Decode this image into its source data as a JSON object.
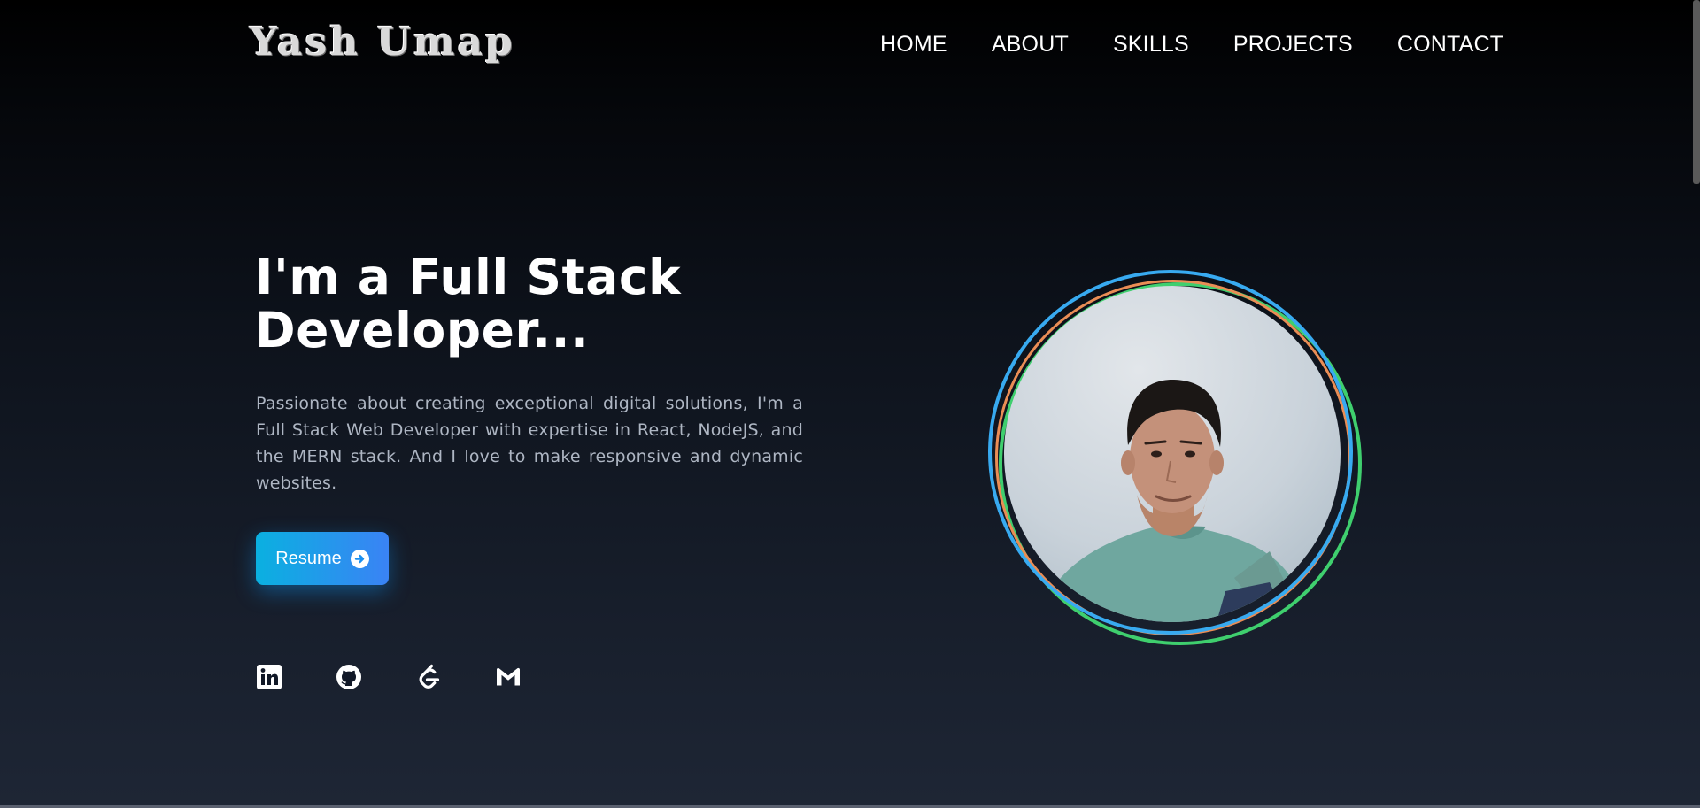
{
  "brand": {
    "name": "Yash Umap"
  },
  "nav": {
    "items": [
      {
        "label": "HOME"
      },
      {
        "label": "ABOUT"
      },
      {
        "label": "SKILLS"
      },
      {
        "label": "PROJECTS"
      },
      {
        "label": "CONTACT"
      }
    ]
  },
  "hero": {
    "title": "I'm a Full Stack Developer...",
    "description": "Passionate about creating exceptional digital solutions, I'm a Full Stack Web Developer with expertise in React, NodeJS, and the MERN stack. And I love to make responsive and dynamic websites.",
    "resume_label": "Resume",
    "resume_icon": "arrow-circle-right-icon"
  },
  "socials": [
    {
      "icon": "linkedin-icon"
    },
    {
      "icon": "github-icon"
    },
    {
      "icon": "leetcode-icon"
    },
    {
      "icon": "gmail-icon"
    }
  ],
  "colors": {
    "accent_blue": "#38aaf0",
    "accent_orange": "#ea8d55",
    "accent_green": "#3fcf6e",
    "button_start": "#0ab0e0",
    "button_end": "#3a83f5"
  }
}
